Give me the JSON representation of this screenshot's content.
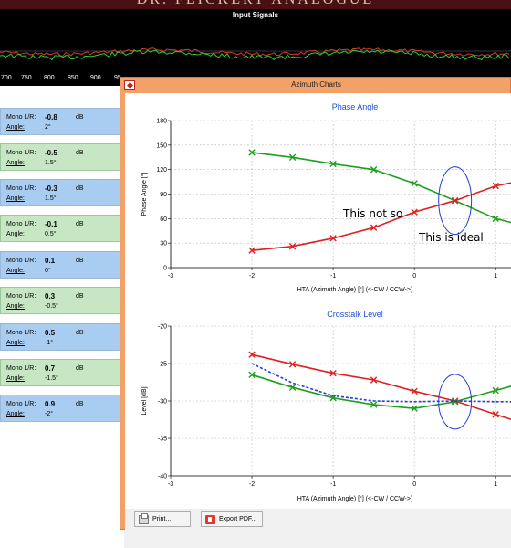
{
  "app": {
    "brand": "DR. FEICKERT ANALOGUE"
  },
  "signals": {
    "title": "Input Signals",
    "ticks": [
      "700",
      "750",
      "800",
      "850",
      "900",
      "95"
    ]
  },
  "mono_rows": [
    {
      "label": "Mono L/R:",
      "value": "-0.8",
      "unit": "dB",
      "angle_label": "Angle:",
      "angle": "2°",
      "color": "blue"
    },
    {
      "label": "Mono L/R:",
      "value": "-0.5",
      "unit": "dB",
      "angle_label": "Angle:",
      "angle": "1.5°",
      "color": "green"
    },
    {
      "label": "Mono L/R:",
      "value": "-0.3",
      "unit": "dB",
      "angle_label": "Angle:",
      "angle": "1.5°",
      "color": "blue"
    },
    {
      "label": "Mono L/R:",
      "value": "-0.1",
      "unit": "dB",
      "angle_label": "Angle:",
      "angle": "0.5°",
      "color": "green"
    },
    {
      "label": "Mono L/R:",
      "value": "0.1",
      "unit": "dB",
      "angle_label": "Angle:",
      "angle": "0°",
      "color": "blue"
    },
    {
      "label": "Mono L/R:",
      "value": "0.3",
      "unit": "dB",
      "angle_label": "Angle:",
      "angle": "-0.5°",
      "color": "green"
    },
    {
      "label": "Mono L/R:",
      "value": "0.5",
      "unit": "dB",
      "angle_label": "Angle:",
      "angle": "-1°",
      "color": "blue"
    },
    {
      "label": "Mono L/R:",
      "value": "0.7",
      "unit": "dB",
      "angle_label": "Angle:",
      "angle": "-1.5°",
      "color": "green"
    },
    {
      "label": "Mono L/R:",
      "value": "0.9",
      "unit": "dB",
      "angle_label": "Angle:",
      "angle": "-2°",
      "color": "blue"
    }
  ],
  "window": {
    "title": "Azimuth Charts",
    "print_label": "Print...",
    "export_label": "Export PDF..."
  },
  "annotations": {
    "not_so": "This not so",
    "ideal": "This is ideal"
  },
  "chart_data": [
    {
      "type": "line",
      "title": "Phase Angle",
      "xlabel": "HTA (Azimuth Angle) [°] (<-CW / CCW->)",
      "ylabel": "Phase Angle [°]",
      "xlim": [
        -3,
        1.2
      ],
      "ylim": [
        0,
        180
      ],
      "xticks": [
        -3,
        -2,
        -1,
        0,
        1
      ],
      "yticks": [
        0,
        30,
        60,
        90,
        120,
        150,
        180
      ],
      "grid": true,
      "series": [
        {
          "color": "#1e9e1e",
          "x": [
            -2,
            -1.5,
            -1,
            -0.5,
            0,
            0.5,
            1,
            1.2
          ],
          "y": [
            141,
            135,
            127,
            120,
            103,
            82,
            60,
            55
          ]
        },
        {
          "color": "#e02020",
          "x": [
            -2,
            -1.5,
            -1,
            -0.5,
            0,
            0.5,
            1,
            1.2
          ],
          "y": [
            21,
            26,
            36,
            49,
            68,
            82,
            100,
            104
          ]
        }
      ]
    },
    {
      "type": "line",
      "title": "Crosstalk Level",
      "xlabel": "HTA (Azimuth Angle) [°] (<-CW / CCW->)",
      "ylabel": "Level [dB]",
      "xlim": [
        -3,
        1.2
      ],
      "ylim": [
        -40,
        -20
      ],
      "xticks": [
        -3,
        -2,
        -1,
        0,
        1
      ],
      "yticks": [
        -40,
        -35,
        -30,
        -25,
        -20
      ],
      "grid": true,
      "series": [
        {
          "color": "#e02020",
          "x": [
            -2,
            -1.5,
            -1,
            -0.5,
            0,
            0.5,
            1,
            1.2
          ],
          "y": [
            -23.8,
            -25.1,
            -26.3,
            -27.2,
            -28.7,
            -30.0,
            -31.8,
            -32.5
          ]
        },
        {
          "color": "#1e9e1e",
          "x": [
            -2,
            -1.5,
            -1,
            -0.5,
            0,
            0.5,
            1,
            1.2
          ],
          "y": [
            -26.5,
            -28.2,
            -29.6,
            -30.5,
            -31.0,
            -30.1,
            -28.6,
            -28.0
          ]
        },
        {
          "color": "#1f3fd6",
          "dashed": true,
          "x": [
            -2,
            -1.5,
            -1,
            -0.5,
            0,
            0.5,
            1,
            1.2
          ],
          "y": [
            -25.0,
            -27.6,
            -29.3,
            -30.0,
            -30.1,
            -30.0,
            -30.1,
            -30.1
          ]
        }
      ]
    }
  ]
}
